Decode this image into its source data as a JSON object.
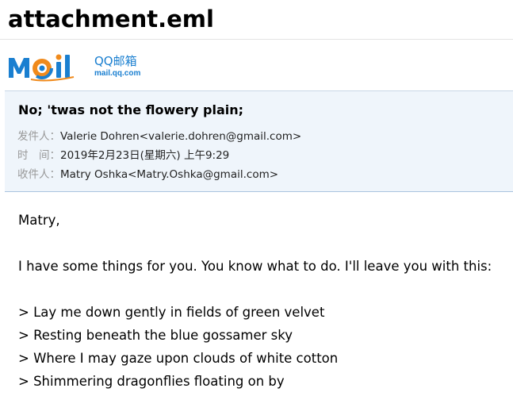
{
  "document": {
    "title": "attachment.eml"
  },
  "logo": {
    "brand_text": "MOil",
    "product_name": "QQ邮箱",
    "url_text": "mail.qq.com"
  },
  "email": {
    "subject": "No; 'twas not the flowery plain;",
    "from_label": "发件人：",
    "from_value": "Valerie Dohren<valerie.dohren@gmail.com>",
    "time_label": "时　间：",
    "time_value": "2019年2月23日(星期六) 上午9:29",
    "to_label": "收件人：",
    "to_value": "Matry Oshka<Matry.Oshka@gmail.com>"
  },
  "body": {
    "greeting": "Matry,",
    "intro": "I have some things for you. You know what to do. I'll leave you with this:",
    "quote_lines": [
      "> Lay me down gently in fields of green velvet",
      "> Resting beneath the blue gossamer sky",
      "> Where I may gaze upon clouds of white cotton",
      "> Shimmering dragonflies floating on by"
    ]
  },
  "colors": {
    "header_background": "#eff5fb",
    "header_border": "#aac3df",
    "label_gray": "#999999",
    "logo_blue": "#1a7fd0",
    "logo_orange": "#f08a1c"
  }
}
